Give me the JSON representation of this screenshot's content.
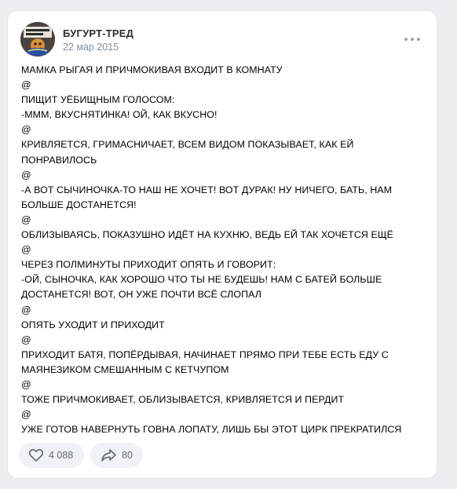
{
  "post": {
    "group_name": "БУГУРТ-ТРЕД",
    "date": "22 мар 2015",
    "avatar_icon": "bugurt-avatar",
    "more_icon": "more-horizontal-icon",
    "lines": [
      "МАМКА РЫГАЯ И ПРИЧМОКИВАЯ ВХОДИТ В КОМНАТУ",
      "@",
      "ПИЩИТ УЁБИЩНЫМ ГОЛОСОМ:",
      "-МММ, ВКУСНЯТИНКА! ОЙ, КАК ВКУСНО!",
      "@",
      "КРИВЛЯЕТСЯ, ГРИМАСНИЧАЕТ, ВСЕМ ВИДОМ ПОКАЗЫВАЕТ, КАК ЕЙ",
      "ПОНРАВИЛОСЬ",
      "@",
      "-А ВОТ СЫЧИНОЧКА-ТО НАШ НЕ ХОЧЕТ! ВОТ ДУРАК! НУ НИЧЕГО, БАТЬ, НАМ",
      "БОЛЬШЕ ДОСТАНЕТСЯ!",
      "@",
      "ОБЛИЗЫВАЯСЬ, ПОКАЗУШНО ИДЁТ НА КУХНЮ, ВЕДЬ ЕЙ ТАК ХОЧЕТСЯ ЕЩЁ",
      "@",
      "ЧЕРЕЗ ПОЛМИНУТЫ ПРИХОДИТ ОПЯТЬ И ГОВОРИТ:",
      "-ОЙ, СЫНОЧКА, КАК ХОРОШО ЧТО ТЫ НЕ БУДЕШЬ! НАМ С БАТЕЙ БОЛЬШЕ",
      "ДОСТАНЕТСЯ! ВОТ, ОН УЖЕ ПОЧТИ ВСЁ СЛОПАЛ",
      "@",
      "ОПЯТЬ УХОДИТ И ПРИХОДИТ",
      "@",
      "ПРИХОДИТ БАТЯ, ПОПЁРДЫВАЯ, НАЧИНАЕТ ПРЯМО ПРИ ТЕБЕ ЕСТЬ ЕДУ С",
      "МАЯНЕЗИКОМ СМЕШАННЫМ С КЕТЧУПОМ",
      "@",
      "ТОЖЕ ПРИЧМОКИВАЕТ, ОБЛИЗЫВАЕТСЯ, КРИВЛЯЕТСЯ И ПЕРДИТ",
      "@",
      "УЖЕ ГОТОВ НАВЕРНУТЬ ГОВНА ЛОПАТУ, ЛИШЬ БЫ ЭТОТ ЦИРК ПРЕКРАТИЛСЯ"
    ]
  },
  "actions": {
    "likes": {
      "icon": "heart-icon",
      "count": "4 088"
    },
    "shares": {
      "icon": "share-arrow-icon",
      "count": "80"
    }
  },
  "colors": {
    "page_background": "#edeef0",
    "card_background": "#ffffff",
    "secondary_text": "#818c99",
    "button_background": "#f0f2f5",
    "button_text": "#626d7a"
  }
}
